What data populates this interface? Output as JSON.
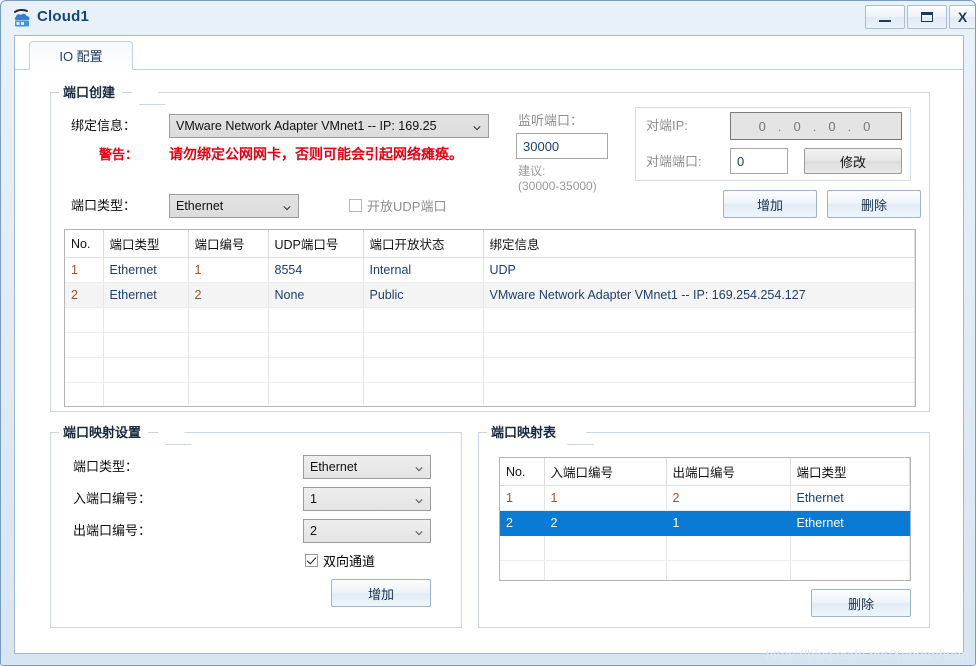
{
  "window": {
    "title": "Cloud1",
    "icon": "cloud-device-icon",
    "controls": {
      "minimize": "—",
      "maximize": "□",
      "close": "X"
    }
  },
  "tabs": [
    {
      "id": "io-config",
      "label": "IO 配置",
      "active": true
    }
  ],
  "port_create": {
    "group_title": "端口创建",
    "binding_label": "绑定信息：",
    "binding_value": "VMware Network Adapter VMnet1 -- IP: 169.25",
    "warning_label": "警告：",
    "warning_text": "请勿绑定公网网卡，否则可能会引起网络瘫痪。",
    "port_type_label": "端口类型：",
    "port_type_value": "Ethernet",
    "udp_checkbox_label": "开放UDP端口",
    "udp_checkbox_checked": false,
    "listen_port_label": "监听端口：",
    "listen_port_value": "30000",
    "suggestion_line1": "建议:",
    "suggestion_line2": "(30000-35000)",
    "peer_ip_label": "对端IP:",
    "peer_ip_octets": [
      "0",
      "0",
      "0",
      "0"
    ],
    "peer_port_label": "对端端口:",
    "peer_port_value": "0",
    "modify_button": "修改",
    "add_button": "增加",
    "delete_button": "删除"
  },
  "port_table": {
    "headers": [
      "No.",
      "端口类型",
      "端口编号",
      "UDP端口号",
      "端口开放状态",
      "绑定信息"
    ],
    "rows": [
      {
        "no": "1",
        "type": "Ethernet",
        "number": "1",
        "udp_port": "8554",
        "state": "Internal",
        "binding": "UDP",
        "selected": false,
        "alt": false
      },
      {
        "no": "2",
        "type": "Ethernet",
        "number": "2",
        "udp_port": "None",
        "state": "Public",
        "binding": "VMware Network Adapter VMnet1 -- IP: 169.254.254.127",
        "selected": false,
        "alt": true
      }
    ],
    "empty_rows": 5
  },
  "map_settings": {
    "group_title": "端口映射设置",
    "port_type_label": "端口类型：",
    "port_type_value": "Ethernet",
    "in_port_label": "入端口编号：",
    "in_port_value": "1",
    "out_port_label": "出端口编号：",
    "out_port_value": "2",
    "bidirectional_label": "双向通道",
    "bidirectional_checked": true,
    "add_button": "增加"
  },
  "map_table": {
    "group_title": "端口映射表",
    "headers": [
      "No.",
      "入端口编号",
      "出端口编号",
      "端口类型"
    ],
    "rows": [
      {
        "no": "1",
        "in_port": "1",
        "out_port": "2",
        "type": "Ethernet",
        "selected": false
      },
      {
        "no": "2",
        "in_port": "2",
        "out_port": "1",
        "type": "Ethernet",
        "selected": true
      }
    ],
    "empty_rows": 3,
    "delete_button": "删除"
  },
  "watermark": "https://blog.csdn.net/Xundanhuan",
  "colors": {
    "accent": "#0a7bd4",
    "warning": "#e60012",
    "title_text": "#13457c",
    "value_text": "#1c3f6e"
  }
}
